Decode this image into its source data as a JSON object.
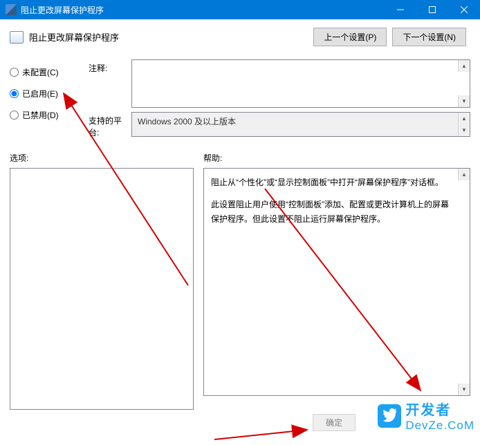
{
  "window": {
    "title": "阻止更改屏幕保护程序"
  },
  "header": {
    "title": "阻止更改屏幕保护程序",
    "prev_btn": "上一个设置(P)",
    "next_btn": "下一个设置(N)"
  },
  "radios": {
    "not_configured": "未配置(C)",
    "enabled": "已启用(E)",
    "disabled": "已禁用(D)"
  },
  "labels": {
    "comment": "注释:",
    "platform": "支持的平台:",
    "options": "选项:",
    "help": "帮助:"
  },
  "platform_value": "Windows 2000 及以上版本",
  "help_text": {
    "p1": "阻止从“个性化”或“显示控制面板”中打开“屏幕保护程序”对话框。",
    "p2": "此设置阻止用户使用“控制面板”添加、配置或更改计算机上的屏幕保护程序。但此设置不阻止运行屏幕保护程序。"
  },
  "buttons": {
    "ok": "确定"
  },
  "watermark": {
    "brand": "开发者",
    "domain": "DevZe.CoM"
  }
}
